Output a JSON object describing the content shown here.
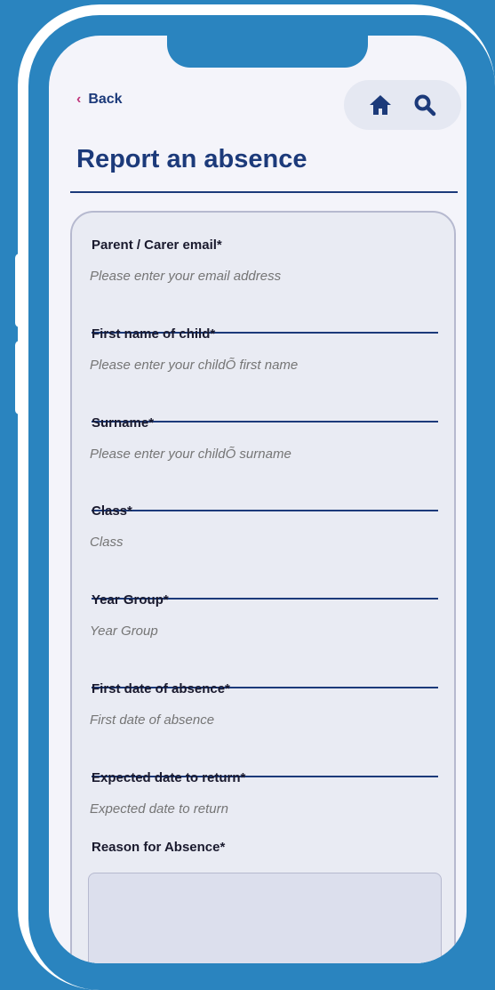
{
  "nav": {
    "back_label": "Back",
    "back_icon": "chevron-left-icon",
    "home_icon": "home-icon",
    "search_icon": "search-icon"
  },
  "page": {
    "title": "Report an absence"
  },
  "form": {
    "fields": [
      {
        "label": "Parent / Carer email*",
        "placeholder": "Please enter your email address"
      },
      {
        "label": "First name of child*",
        "placeholder": "Please enter your childÕ first name"
      },
      {
        "label": "Surname*",
        "placeholder": "Please enter your childÕ surname"
      },
      {
        "label": "Class*",
        "placeholder": "Class"
      },
      {
        "label": "Year Group*",
        "placeholder": "Year Group"
      },
      {
        "label": "First date of absence*",
        "placeholder": "First date of absence"
      },
      {
        "label": "Expected date to return*",
        "placeholder": "Expected date to return"
      }
    ],
    "reason_label": "Reason for Absence*"
  },
  "colors": {
    "background": "#2a84bf",
    "primary": "#1c3a7a",
    "accent": "#c0347a",
    "screen": "#f4f4fa"
  }
}
